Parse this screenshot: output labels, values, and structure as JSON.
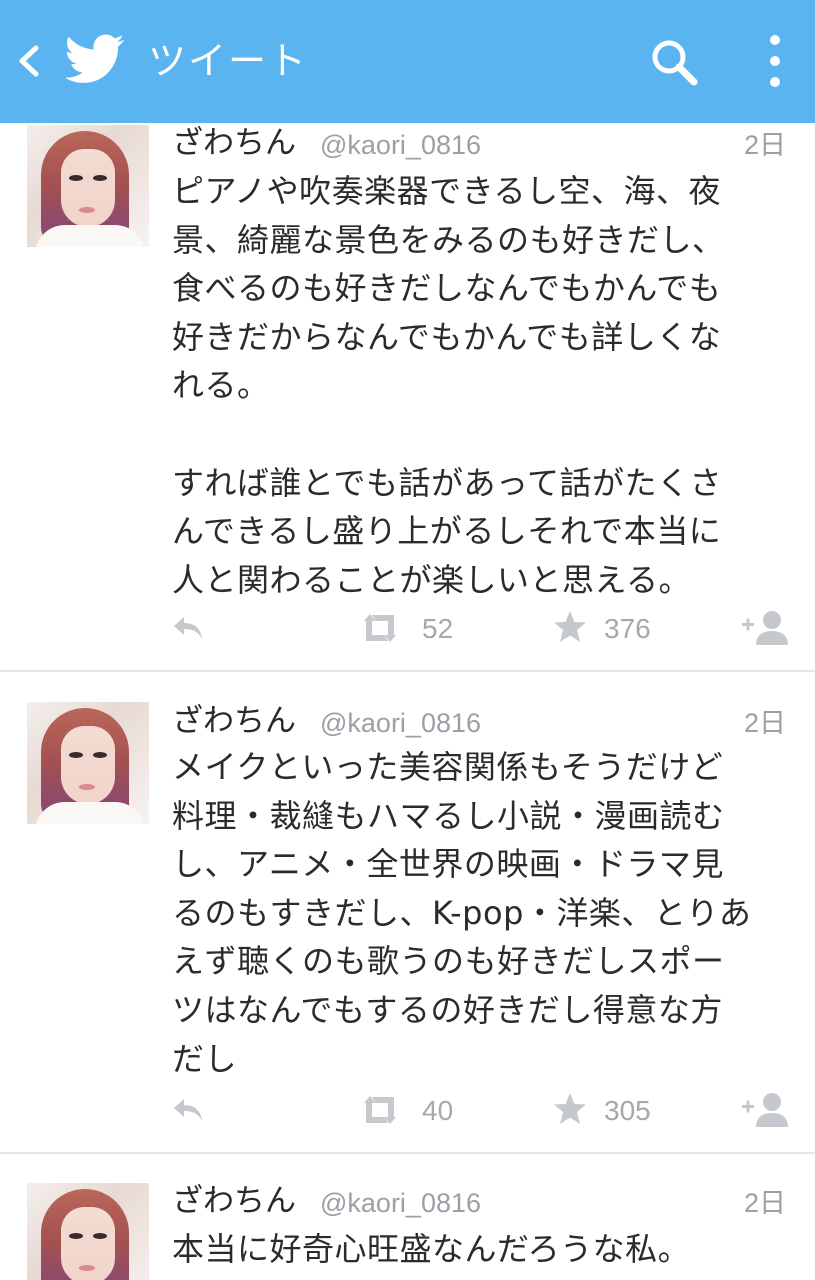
{
  "appbar": {
    "title": "ツイート",
    "color": "#5ab4ef",
    "icons": [
      "back-icon",
      "twitter-bird-icon",
      "search-icon",
      "overflow-menu-icon"
    ]
  },
  "tweets": [
    {
      "name": "ざわちん",
      "handle": "@kaori_0816",
      "time": "2日",
      "text": "ピアノや吹奏楽器できるし空、海、夜\n景、綺麗な景色をみるのも好きだし、\n食べるのも好きだしなんでもかんでも\n好きだからなんでもかんでも詳しくな\nれる。\n\nすれば誰とでも話があって話がたくさ\nんできるし盛り上がるしそれで本当に\n人と関わることが楽しいと思える。",
      "retweets": "52",
      "favorites": "376"
    },
    {
      "name": "ざわちん",
      "handle": "@kaori_0816",
      "time": "2日",
      "text": "メイクといった美容関係もそうだけど\n料理・裁縫もハマるし小説・漫画読む\nし、アニメ・全世界の映画・ドラマ見\nるのもすきだし、K-pop・洋楽、とりあ\nえず聴くのも歌うのも好きだしスポー\nツはなんでもするの好きだし得意な方\nだし",
      "retweets": "40",
      "favorites": "305"
    },
    {
      "name": "ざわちん",
      "handle": "@kaori_0816",
      "time": "2日",
      "text": "本当に好奇心旺盛なんだろうな私。"
    }
  ]
}
